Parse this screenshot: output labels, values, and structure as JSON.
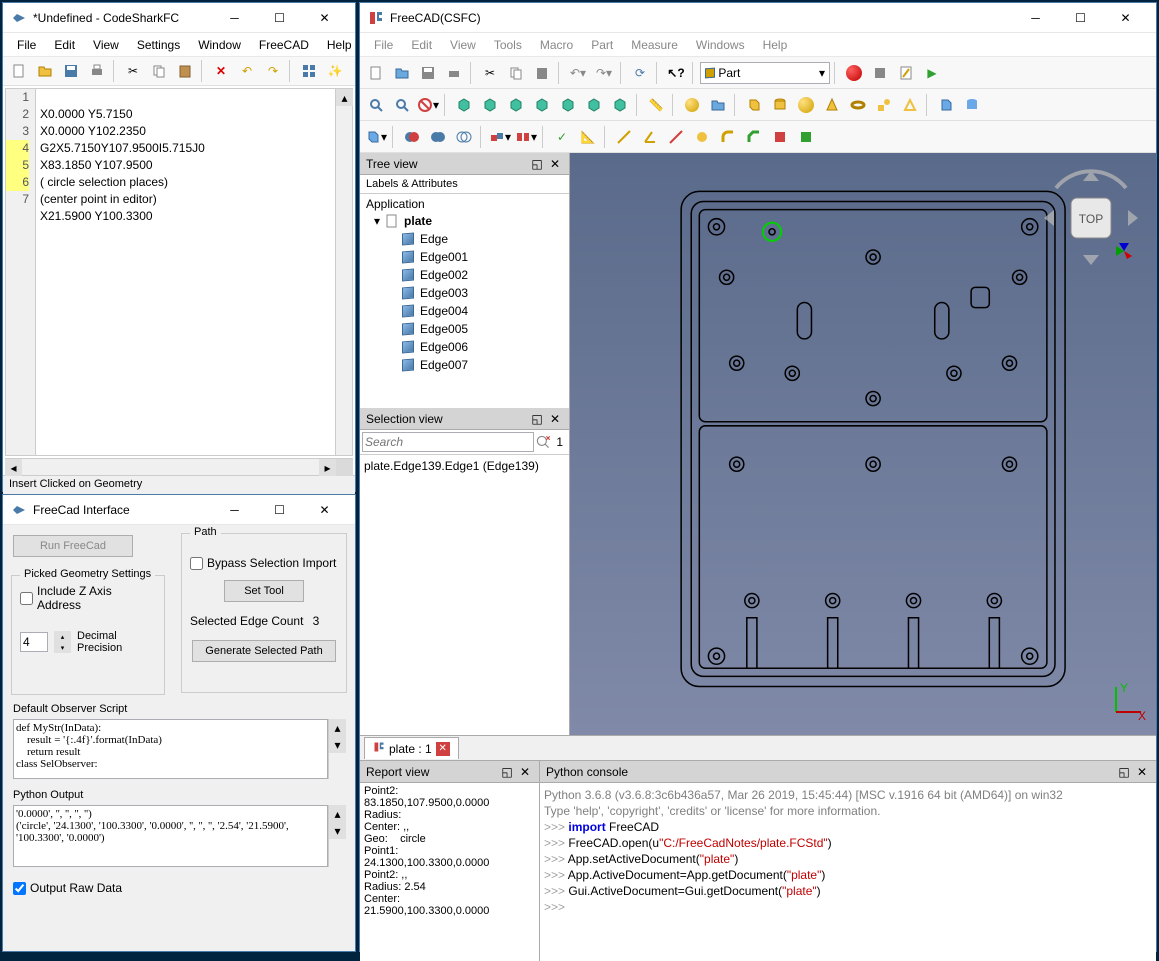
{
  "codeshark": {
    "title": "*Undefined - CodeSharkFC",
    "menu": [
      "File",
      "Edit",
      "View",
      "Settings",
      "Window",
      "FreeCAD",
      "Help"
    ],
    "lines": [
      "1",
      "2",
      "3",
      "4",
      "5",
      "6",
      "7"
    ],
    "code": [
      "X0.0000 Y5.7150",
      "X0.0000 Y102.2350",
      "G2X5.7150Y107.9500I5.715J0",
      "X83.1850 Y107.9500",
      "( circle selection places)",
      "(center point in editor)",
      "X21.5900 Y100.3300"
    ],
    "status": "Insert Clicked on Geometry"
  },
  "fcif": {
    "title": "FreeCad Interface",
    "run_btn": "Run FreeCad",
    "picked_grp": "Picked Geometry Settings",
    "include_z": "Include Z Axis Address",
    "dec_val": "4",
    "dec_lbl": "Decimal Precision",
    "path_grp": "Path",
    "bypass": "Bypass Selection Import",
    "settool": "Set Tool",
    "edgecount_lbl": "Selected Edge Count",
    "edgecount_val": "3",
    "genpath": "Generate Selected Path",
    "obs_lbl": "Default Observer Script",
    "obs_txt": "def MyStr(InData):\n    result = '{:.4f}'.format(InData)\n    return result\nclass SelObserver:",
    "pyout_lbl": "Python Output",
    "pyout_txt": "'0.0000', '', '', '', '')\n('circle', '24.1300', '100.3300', '0.0000', '', '', '', '2.54', '21.5900', '100.3300', '0.0000')",
    "rawdata": "Output Raw Data"
  },
  "freecad": {
    "title": "FreeCAD(CSFC)",
    "menu": [
      "File",
      "Edit",
      "View",
      "Tools",
      "Macro",
      "Part",
      "Measure",
      "Windows",
      "Help"
    ],
    "combo": "Part",
    "tree_title": "Tree view",
    "tree_labels": "Labels & Attributes",
    "tree_app": "Application",
    "tree_doc": "plate",
    "tree_items": [
      "Edge",
      "Edge001",
      "Edge002",
      "Edge003",
      "Edge004",
      "Edge005",
      "Edge006",
      "Edge007"
    ],
    "sel_title": "Selection view",
    "sel_search": "Search",
    "sel_count": "1",
    "sel_item": "plate.Edge139.Edge1 (Edge139)",
    "tab": "plate : 1",
    "report_title": "Report view",
    "report_txt": "Point2:\n83.1850,107.9500,0.0000\nRadius:\nCenter: ,,\nGeo:    circle\nPoint1:\n24.1300,100.3300,0.0000\nPoint2: ,,\nRadius: 2.54\nCenter:\n21.5900,100.3300,0.0000",
    "pycon_title": "Python console",
    "pycon_info1": "Python 3.6.8 (v3.6.8:3c6b436a57, Mar 26 2019, 15:45:44) [MSC v.1916 64 bit (AMD64)] on win32",
    "pycon_info2": "Type 'help', 'copyright', 'credits' or 'license' for more information.",
    "py_l1_a": "import",
    "py_l1_b": " FreeCAD",
    "py_l2_a": "FreeCAD.open(u",
    "py_l2_b": "\"C:/FreeCadNotes/plate.FCStd\"",
    "py_l2_c": ")",
    "py_l3_a": "App.setActiveDocument(",
    "py_l3_b": "\"plate\"",
    "py_l3_c": ")",
    "py_l4_a": "App.ActiveDocument=App.getDocument(",
    "py_l4_b": "\"plate\"",
    "py_l4_c": ")",
    "py_l5_a": "Gui.ActiveDocument=Gui.getDocument(",
    "py_l5_b": "\"plate\"",
    "py_l5_c": ")",
    "navcube": "TOP"
  }
}
